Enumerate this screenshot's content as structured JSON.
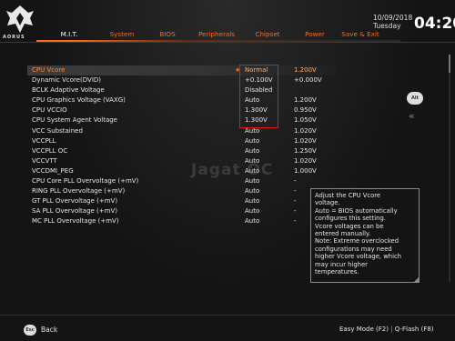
{
  "brand": {
    "logo_text": "AORUS"
  },
  "header": {
    "date": "10/09/2018",
    "weekday": "Tuesday",
    "time": "04:20",
    "tabs": [
      {
        "label": "M.I.T."
      },
      {
        "label": "System"
      },
      {
        "label": "BIOS"
      },
      {
        "label": "Peripherals"
      },
      {
        "label": "Chipset"
      },
      {
        "label": "Power"
      },
      {
        "label": "Save & Exit"
      }
    ]
  },
  "settings": [
    {
      "label": "CPU Vcore",
      "value": "Normal",
      "current": "1.200V"
    },
    {
      "label": "Dynamic Vcore(DVID)",
      "value": "+0.100V",
      "current": "+0.000V"
    },
    {
      "label": "BCLK Adaptive Voltage",
      "value": "Disabled",
      "current": ""
    },
    {
      "label": "CPU Graphics Voltage (VAXG)",
      "value": "Auto",
      "current": "1.200V"
    },
    {
      "label": "CPU VCCIO",
      "value": "1.300V",
      "current": "0.950V"
    },
    {
      "label": "CPU System Agent Voltage",
      "value": "1.300V",
      "current": "1.050V"
    },
    {
      "label": "VCC Substained",
      "value": "Auto",
      "current": "1.020V"
    },
    {
      "label": "VCCPLL",
      "value": "Auto",
      "current": "1.020V"
    },
    {
      "label": "VCCPLL OC",
      "value": "Auto",
      "current": "1.250V"
    },
    {
      "label": "VCCVTT",
      "value": "Auto",
      "current": "1.020V"
    },
    {
      "label": "VCCDMI_PEG",
      "value": "Auto",
      "current": "1.000V"
    },
    {
      "label": "CPU Core PLL Overvoltage (+mV)",
      "value": "Auto",
      "current": "-"
    },
    {
      "label": "RING PLL Overvoltage (+mV)",
      "value": "Auto",
      "current": "-"
    },
    {
      "label": "GT PLL Overvoltage (+mV)",
      "value": "Auto",
      "current": "-"
    },
    {
      "label": "SA PLL Overvoltage (+mV)",
      "value": "Auto",
      "current": "-"
    },
    {
      "label": "MC PLL Overvoltage (+mV)",
      "value": "Auto",
      "current": "-"
    }
  ],
  "selected_marker": "★",
  "watermark": "Jagat OC",
  "help": {
    "lines": [
      "Adjust the CPU Vcore",
      "voltage.",
      "Auto = BIOS automatically",
      "configures this setting.",
      "Vcore voltages can be",
      "entered manually.",
      "Note: Extreme overclocked",
      "configurations may need",
      "higher Vcore voltage, which",
      "may incur higher",
      "temperatures."
    ]
  },
  "side": {
    "alt_label": "Alt",
    "collapse_glyph": "«"
  },
  "footer": {
    "esc_label": "Esc",
    "back_label": "Back",
    "easy_mode": "Easy Mode (F2)",
    "separator": "|",
    "qflash": "Q-Flash (F8)"
  },
  "colors": {
    "accent": "#ff6a1a",
    "highlight_box": "#e01818"
  }
}
